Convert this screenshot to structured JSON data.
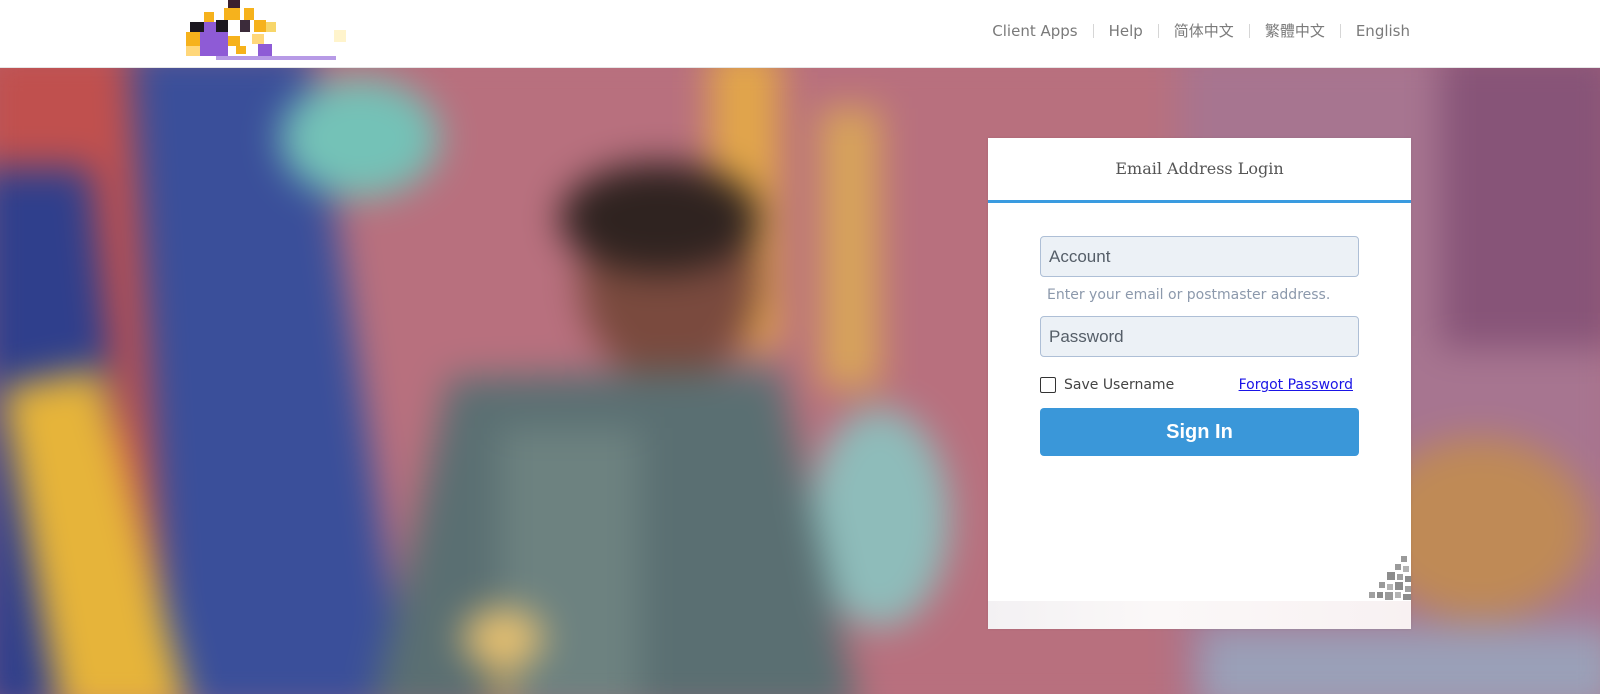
{
  "header": {
    "logo": "company-logo",
    "nav": [
      {
        "label": "Client Apps"
      },
      {
        "label": "Help"
      },
      {
        "label": "简体中文"
      },
      {
        "label": "繁體中文"
      },
      {
        "label": "English"
      }
    ]
  },
  "login": {
    "title": "Email Address Login",
    "account_placeholder": "Account",
    "account_hint": "Enter your email or postmaster address.",
    "password_placeholder": "Password",
    "save_username_label": "Save Username",
    "forgot_password_label": "Forgot Password",
    "signin_label": "Sign In",
    "save_username_checked": false
  },
  "colors": {
    "accent": "#3a97d9",
    "link": "#1a14e6",
    "field_bg": "#ecf1f6"
  },
  "icons": {
    "corner": "qr-code-icon"
  }
}
